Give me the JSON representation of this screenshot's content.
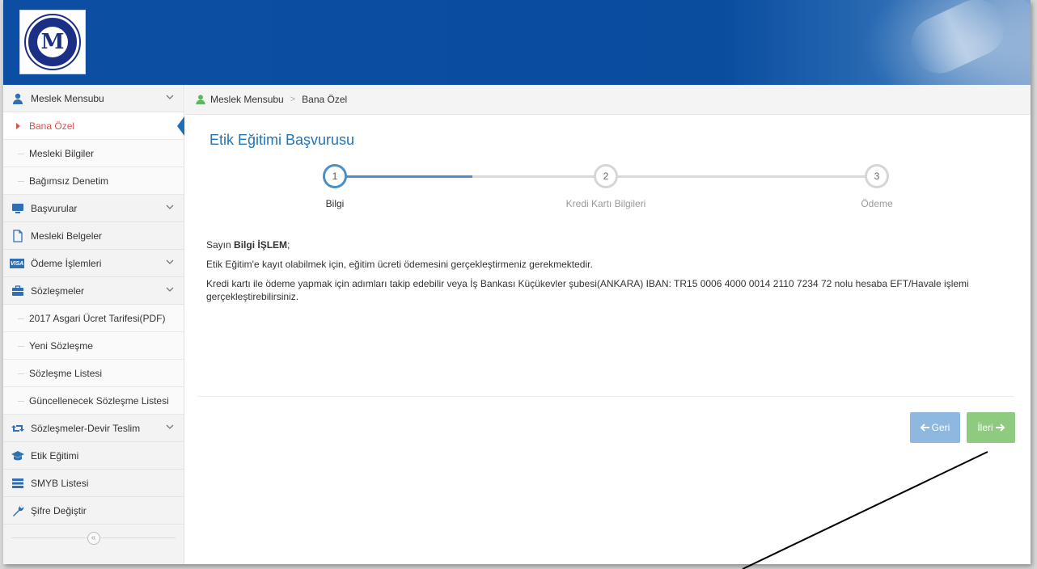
{
  "sidebar": {
    "meslek_mensubu": "Meslek Mensubu",
    "bana_ozel": "Bana Özel",
    "mesleki_bilgiler": "Mesleki Bilgiler",
    "bagimsiz_denetim": "Bağımsız Denetim",
    "basvurular": "Başvurular",
    "mesleki_belgeler": "Mesleki Belgeler",
    "visa_label": "VISA",
    "odeme_islemleri": "Ödeme İşlemleri",
    "sozlesmeler": "Sözleşmeler",
    "asgari_ucret": "2017 Asgari Ücret Tarifesi(PDF)",
    "yeni_sozlesme": "Yeni Sözleşme",
    "sozlesme_listesi": "Sözleşme Listesi",
    "guncellenecek": "Güncellenecek Sözleşme Listesi",
    "devir_teslim": "Sözleşmeler-Devir Teslim",
    "etik_egitimi": "Etik Eğitimi",
    "smyb_listesi": "SMYB Listesi",
    "sifre_degistir": "Şifre Değiştir",
    "collapse_glyph": "«"
  },
  "breadcrumb": {
    "root": "Meslek Mensubu",
    "separator": ">",
    "current": "Bana Özel"
  },
  "main": {
    "title": "Etik Eğitimi Başvurusu"
  },
  "steps": [
    {
      "number": "1",
      "label": "Bilgi",
      "active": true
    },
    {
      "number": "2",
      "label": "Kredi Kartı Bilgileri",
      "active": false
    },
    {
      "number": "3",
      "label": "Ödeme",
      "active": false
    }
  ],
  "content": {
    "greeting_prefix": "Sayın ",
    "greeting_name": "Bilgi İŞLEM",
    "greeting_suffix": ";",
    "paragraph1": "Etik Eğitim'e kayıt olabilmek için, eğitim ücreti ödemesini gerçekleştirmeniz gerekmektedir.",
    "paragraph2": "Kredi kartı ile ödeme yapmak için adımları takip edebilir veya İş Bankası Küçükevler şubesi(ANKARA) IBAN: TR15 0006 4000 0014 2110 7234 72 nolu hesaba EFT/Havale işlemi gerçekleştirebilirsiniz."
  },
  "buttons": {
    "back": "Geri",
    "next": "İleri"
  },
  "colors": {
    "header_blue": "#0b4ea3",
    "link_blue": "#2574b4",
    "active_red": "#d9534f",
    "back_button": "#8fb8e0",
    "next_button": "#8fcb7f"
  }
}
